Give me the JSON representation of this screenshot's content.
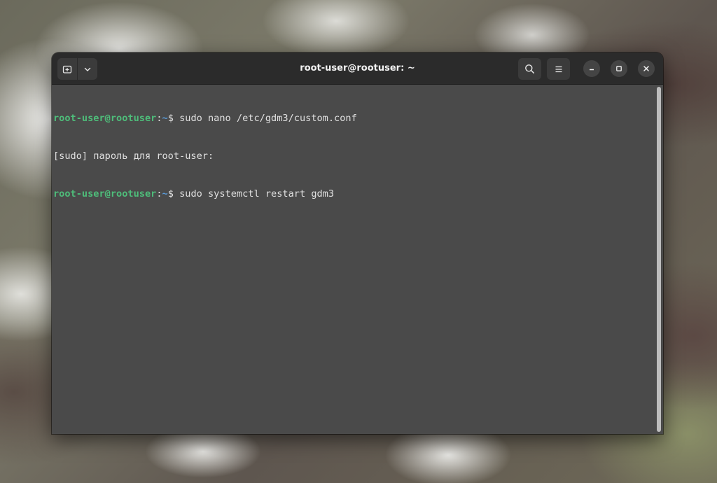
{
  "window": {
    "title": "root-user@rootuser: ~"
  },
  "header": {
    "new_tab_icon": "new-tab-icon",
    "tab_menu_icon": "chevron-down-icon",
    "search_icon": "search-icon",
    "menu_icon": "hamburger-icon",
    "minimize_icon": "minimize-icon",
    "maximize_icon": "maximize-icon",
    "close_icon": "close-icon"
  },
  "terminal": {
    "lines": [
      {
        "user": "root-user@rootuser",
        "sep": ":",
        "path": "~",
        "prompt": "$ ",
        "command": "sudo nano /etc/gdm3/custom.conf"
      },
      {
        "text": "[sudo] пароль для root-user: "
      },
      {
        "user": "root-user@rootuser",
        "sep": ":",
        "path": "~",
        "prompt": "$ ",
        "command": "sudo systemctl restart gdm3"
      }
    ]
  },
  "colors": {
    "prompt_user": "#4ebd7a",
    "prompt_path": "#5a9bd8",
    "terminal_bg": "#4a4a4a",
    "headerbar_bg": "#2b2b2b"
  }
}
